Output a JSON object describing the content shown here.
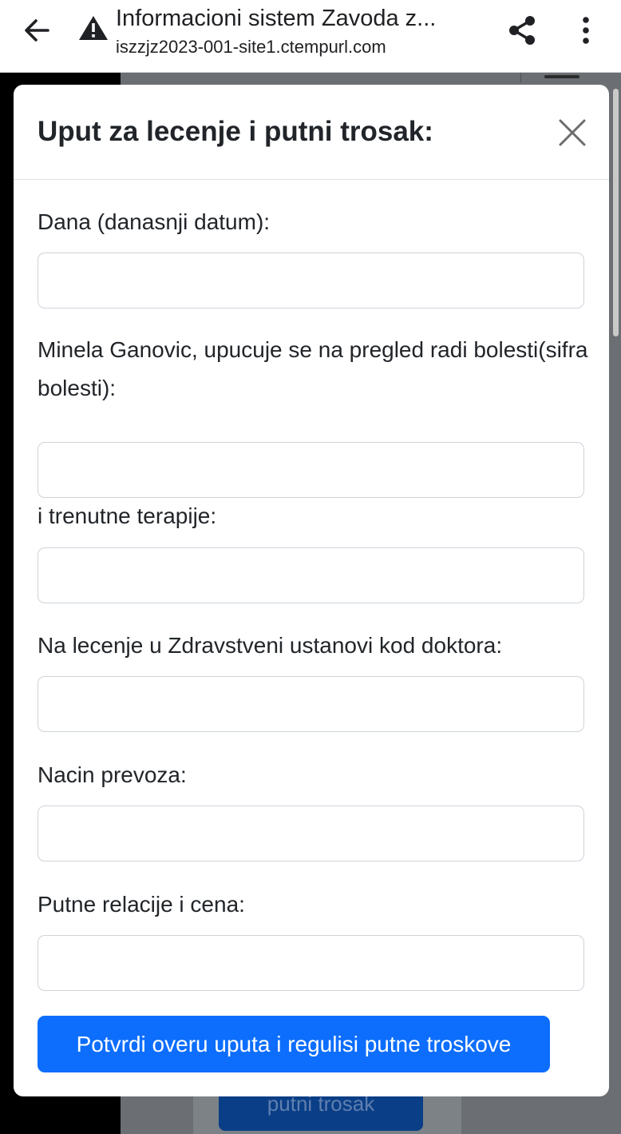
{
  "browser": {
    "page_title": "Informacioni sistem Zavoda z...",
    "url": "iszzjz2023-001-site1.ctempurl.com",
    "icons": {
      "back": "arrow-back-icon",
      "warning": "warning-triangle-icon",
      "share": "share-icon",
      "menu": "more-vertical-icon"
    }
  },
  "background": {
    "button_label": "putni trosak"
  },
  "modal": {
    "title": "Uput za lecenje i putni trosak:",
    "close_icon": "close-icon",
    "fields": {
      "date_label": "Dana (danasnji datum):",
      "date_value": "",
      "illness_label": "Minela Ganovic, upucuje se na pregled radi bolesti(sifra bolesti):",
      "illness_value": "",
      "therapy_label": "i trenutne terapije:",
      "therapy_value": "",
      "doctor_label": "Na lecenje u Zdravstveni ustanovi kod doktora:",
      "doctor_value": "",
      "transport_label": "Nacin prevoza:",
      "transport_value": "",
      "route_label": "Putne relacije i cena:",
      "route_value": ""
    },
    "submit_label": "Potvrdi overu uputa i regulisi putne troskove"
  },
  "colors": {
    "primary": "#0d6efd",
    "backdrop": "#6b6f73",
    "input_border": "#ced4da",
    "text": "#212529"
  }
}
